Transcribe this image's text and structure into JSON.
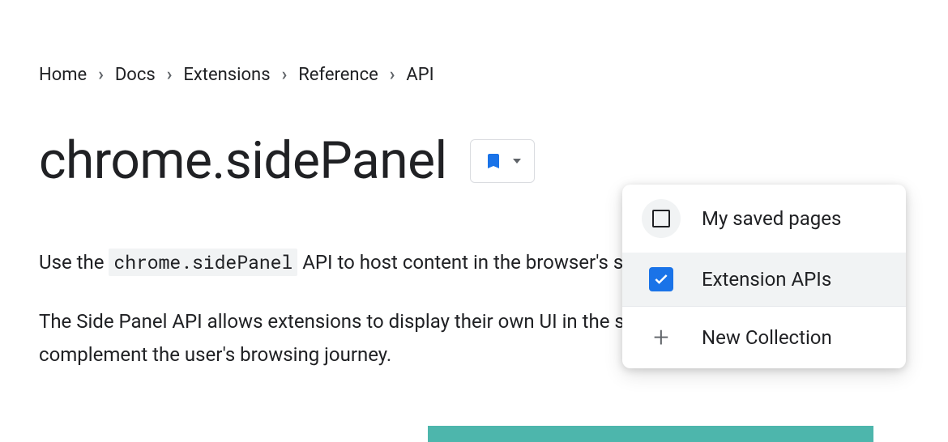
{
  "breadcrumb": [
    {
      "label": "Home"
    },
    {
      "label": "Docs"
    },
    {
      "label": "Extensions"
    },
    {
      "label": "Reference"
    },
    {
      "label": "API"
    }
  ],
  "title": "chrome.sidePanel",
  "body": {
    "p1_pre": "Use the ",
    "p1_code": "chrome.sidePanel",
    "p1_post": " API to host content in the browser's side panel alongside t",
    "p2": "The Side Panel API allows extensions to display their own UI in the side panel, enabling p complement the user's browsing journey."
  },
  "dropdown": {
    "item1": "My saved pages",
    "item2": "Extension APIs",
    "item3": "New Collection"
  }
}
